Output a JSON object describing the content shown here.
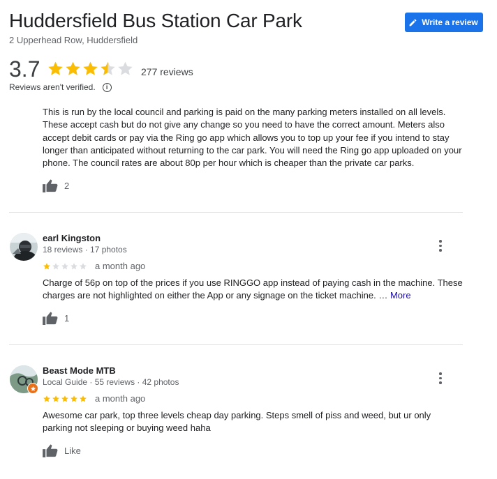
{
  "place": {
    "name": "Huddersfield Bus Station Car Park",
    "address": "2 Upperhead Row, Huddersfield",
    "rating": "3.7",
    "rating_value": 3.7,
    "review_count": "277 reviews",
    "unverified_note": "Reviews aren't verified.",
    "info_icon": "info-icon"
  },
  "write_review": {
    "label": "Write a review",
    "icon": "pencil-icon"
  },
  "colors": {
    "star_filled": "#fbbc04",
    "star_empty": "#dadce0",
    "accent": "#1a73e8"
  },
  "reviews": [
    {
      "text": "This is run by the local council and parking is paid on the many parking meters installed on all levels. These accept cash but do not give any change so you need to have the correct amount. Meters also accept debit cards or pay via the Ring go app which allows you to top up your fee if you intend to stay longer than anticipated without returning to the car park. You will need the Ring go app uploaded on your phone. The council rates are about 80p per hour which is cheaper than the private car parks.",
      "likes": "2"
    },
    {
      "author": "earl Kingston",
      "meta": "18 reviews · 17 photos",
      "stars": 1,
      "date": "a month ago",
      "text": "Charge of 56p on top of the prices if you use RINGGO app instead of paying cash in the machine. These charges are not highlighted on either the App or any signage on the ticket machine. …",
      "more": "More",
      "likes": "1"
    },
    {
      "author": "Beast Mode MTB",
      "meta": "Local Guide · 55 reviews · 42 photos",
      "stars": 5,
      "date": "a month ago",
      "text": "Awesome car park, top three levels cheap day parking. Steps smell of piss and weed, but ur only parking not sleeping or buying weed haha",
      "likes": "Like"
    }
  ]
}
